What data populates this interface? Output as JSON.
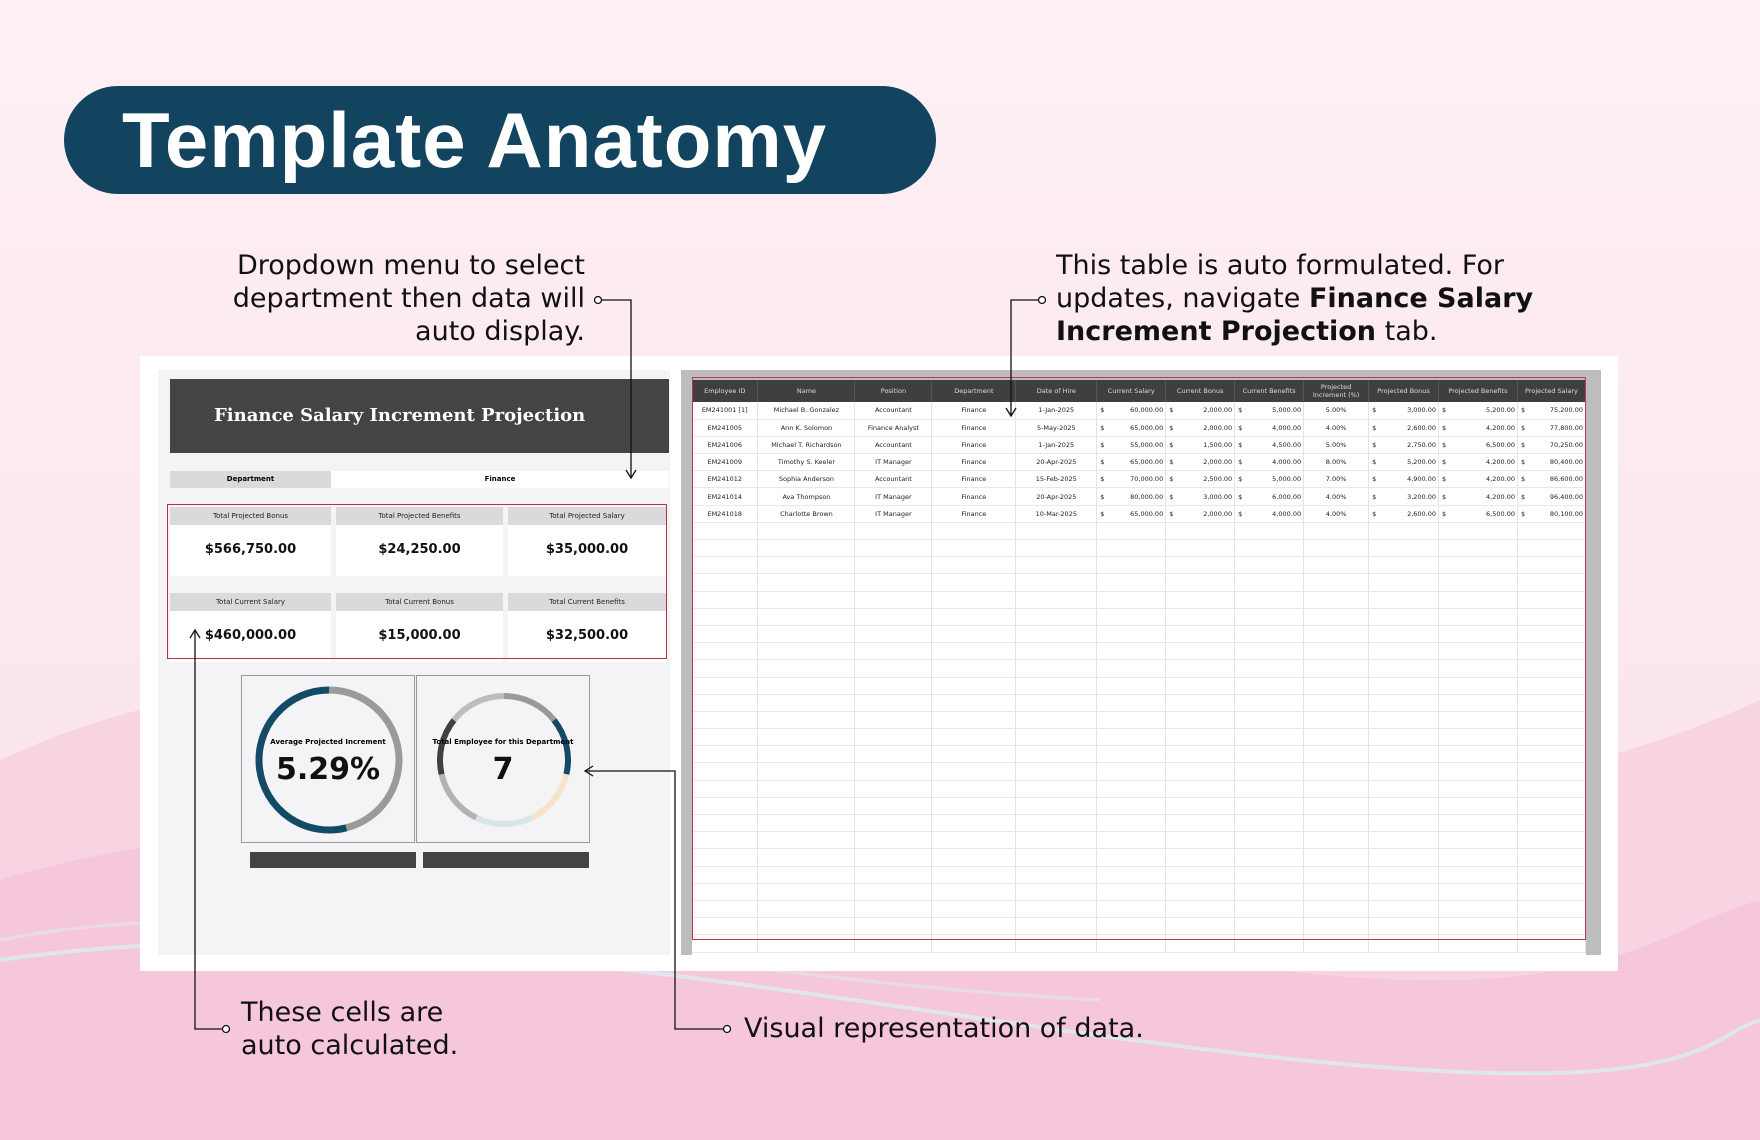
{
  "page_title": "Template Anatomy",
  "callouts": {
    "dropdown": [
      "Dropdown menu to select",
      "department then data will",
      "auto display."
    ],
    "table_pre": "This table is auto formulated. For updates, navigate ",
    "table_bold": "Finance Salary Increment Projection",
    "table_post": " tab.",
    "cells": [
      "These cells are",
      "auto calculated."
    ],
    "visual": "Visual representation of data."
  },
  "dashboard": {
    "title": "Finance Salary Increment Projection",
    "department_label": "Department",
    "department_value": "Finance",
    "kpis": [
      {
        "label": "Total Projected Bonus",
        "value": "$566,750.00"
      },
      {
        "label": "Total Projected Benefits",
        "value": "$24,250.00"
      },
      {
        "label": "Total Projected Salary",
        "value": "$35,000.00"
      },
      {
        "label": "Total Current Salary",
        "value": "$460,000.00"
      },
      {
        "label": "Total Current Bonus",
        "value": "$15,000.00"
      },
      {
        "label": "Total Current Benefits",
        "value": "$32,500.00"
      }
    ],
    "donut_increment": {
      "label": "Average Projected Increment",
      "value": "5.29%",
      "colors": [
        "#134a66",
        "#9a9a9a"
      ]
    },
    "donut_employees": {
      "label": "Total Employee for this Department",
      "value": "7",
      "colors": [
        "#9a9a9a",
        "#134a66",
        "#f7e3c9",
        "#d5e5e8",
        "#b3b3b3",
        "#404040",
        "#bdbdbd"
      ]
    }
  },
  "table": {
    "columns": [
      "Employee ID",
      "Name",
      "Position",
      "Department",
      "Date of Hire",
      "Current Salary",
      "Current Bonus",
      "Current Benefits",
      "Projected Increment (%)",
      "Projected Bonus",
      "Projected Benefits",
      "Projected Salary"
    ],
    "rows": [
      [
        "EM241001 [1]",
        "Michael B. Gonzalez",
        "Accountant",
        "Finance",
        "1-Jan-2025",
        "60,000.00",
        "2,000.00",
        "5,000.00",
        "5.00%",
        "3,000.00",
        "5,200.00",
        "75,200.00"
      ],
      [
        "EM241005",
        "Ann K. Solomon",
        "Finance Analyst",
        "Finance",
        "5-May-2025",
        "65,000.00",
        "2,000.00",
        "4,000.00",
        "4.00%",
        "2,600.00",
        "4,200.00",
        "77,800.00"
      ],
      [
        "EM241006",
        "Michael T. Richardson",
        "Accountant",
        "Finance",
        "1-Jan-2025",
        "55,000.00",
        "1,500.00",
        "4,500.00",
        "5.00%",
        "2,750.00",
        "6,500.00",
        "70,250.00"
      ],
      [
        "EM241009",
        "Timothy S. Keeler",
        "IT Manager",
        "Finance",
        "20-Apr-2025",
        "65,000.00",
        "2,000.00",
        "4,000.00",
        "8.00%",
        "5,200.00",
        "4,200.00",
        "80,400.00"
      ],
      [
        "EM241012",
        "Sophia Anderson",
        "Accountant",
        "Finance",
        "15-Feb-2025",
        "70,000.00",
        "2,500.00",
        "5,000.00",
        "7.00%",
        "4,900.00",
        "4,200.00",
        "86,600.00"
      ],
      [
        "EM241014",
        "Ava Thompson",
        "IT Manager",
        "Finance",
        "20-Apr-2025",
        "80,000.00",
        "3,000.00",
        "6,000.00",
        "4.00%",
        "3,200.00",
        "4,200.00",
        "96,400.00"
      ],
      [
        "EM241018",
        "Charlotte Brown",
        "IT Manager",
        "Finance",
        "10-Mar-2025",
        "65,000.00",
        "2,000.00",
        "4,000.00",
        "4.00%",
        "2,600.00",
        "6,500.00",
        "80,100.00"
      ]
    ],
    "currency_symbol": "$"
  },
  "colors": {
    "title_pill": "#12445f",
    "header_dark": "#444444",
    "highlight_red": "#b5323f",
    "background": "#fdeef4"
  }
}
